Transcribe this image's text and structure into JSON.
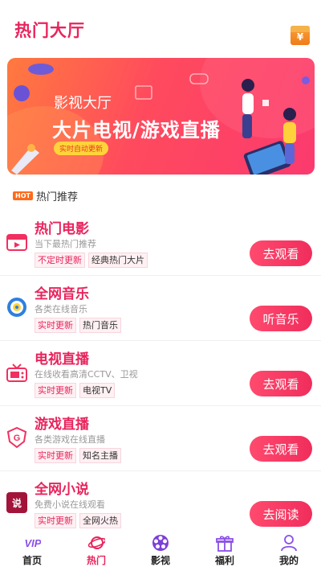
{
  "header": {
    "title": "热门大厅",
    "redpacket_symbol": "¥"
  },
  "banner": {
    "subtitle": "影视大厅",
    "title": "大片电视/游戏直播",
    "tag": "实时自动更新"
  },
  "section": {
    "badge": "HOT",
    "title": "热门推荐"
  },
  "items": [
    {
      "title": "热门电影",
      "desc": "当下最热门推荐",
      "tags": [
        "不定时更新",
        "经典热门大片"
      ],
      "button": "去观看",
      "icon": "film-icon"
    },
    {
      "title": "全网音乐",
      "desc": "各类在线音乐",
      "tags": [
        "实时更新",
        "热门音乐"
      ],
      "button": "听音乐",
      "icon": "music-disc-icon"
    },
    {
      "title": "电视直播",
      "desc": "在线收看高清CCTV、卫视",
      "tags": [
        "实时更新",
        "电视TV"
      ],
      "button": "去观看",
      "icon": "tv-icon"
    },
    {
      "title": "游戏直播",
      "desc": "各类游戏在线直播",
      "tags": [
        "实时更新",
        "知名主播"
      ],
      "button": "去观看",
      "icon": "game-shield-icon"
    },
    {
      "title": "全网小说",
      "desc": "免费小说在线观看",
      "tags": [
        "实时更新",
        "全网火热"
      ],
      "button": "去阅读",
      "icon": "novel-icon"
    }
  ],
  "tabs": [
    {
      "label": "首页",
      "icon": "vip-icon"
    },
    {
      "label": "热门",
      "icon": "planet-icon",
      "active": true
    },
    {
      "label": "影视",
      "icon": "film-reel-icon"
    },
    {
      "label": "福利",
      "icon": "gift-icon"
    },
    {
      "label": "我的",
      "icon": "user-icon"
    }
  ],
  "colors": {
    "accent": "#e8245c",
    "button": "#f02d5c",
    "hot": "#ff6a1a"
  }
}
